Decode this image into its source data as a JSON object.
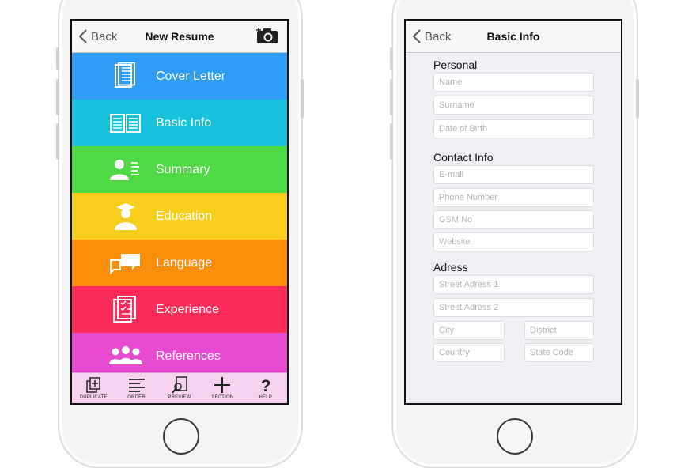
{
  "left_screen": {
    "nav": {
      "back_label": "Back",
      "title": "New Resume"
    },
    "menu": [
      {
        "label": "Cover Letter",
        "color": "#2f9df3",
        "icon": "document-list-icon"
      },
      {
        "label": "Basic Info",
        "color": "#18c2dd",
        "icon": "id-card-icon"
      },
      {
        "label": "Summary",
        "color": "#4fd944",
        "icon": "person-summary-icon"
      },
      {
        "label": "Education",
        "color": "#f8ce1c",
        "icon": "graduate-icon"
      },
      {
        "label": "Language",
        "color": "#fb8f0c",
        "icon": "speech-bubbles-icon"
      },
      {
        "label": "Experience",
        "color": "#fb2c5a",
        "icon": "checklist-icon"
      },
      {
        "label": "References",
        "color": "#e64bd0",
        "icon": "people-group-icon"
      }
    ],
    "toolbar": [
      {
        "label": "DUPLICATE",
        "icon": "duplicate-icon"
      },
      {
        "label": "ORDER",
        "icon": "lines-icon"
      },
      {
        "label": "PREVIEW",
        "icon": "preview-icon"
      },
      {
        "label": "SECTION",
        "icon": "plus-icon"
      },
      {
        "label": "HELP",
        "icon": "question-icon"
      }
    ]
  },
  "right_screen": {
    "nav": {
      "back_label": "Back",
      "title": "Basic Info"
    },
    "personal": {
      "heading": "Personal",
      "name": "Name",
      "surname": "Surname",
      "dob": "Date of Birth"
    },
    "contact": {
      "heading": "Contact Info",
      "email": "E-mail",
      "phone": "Phone Number",
      "gsm": "GSM No",
      "website": "Website"
    },
    "address": {
      "heading": "Adress",
      "street1": "Street Adress 1",
      "street2": "Street Adress 2",
      "city": "City",
      "district": "District",
      "country": "Country",
      "state": "State Code"
    }
  }
}
